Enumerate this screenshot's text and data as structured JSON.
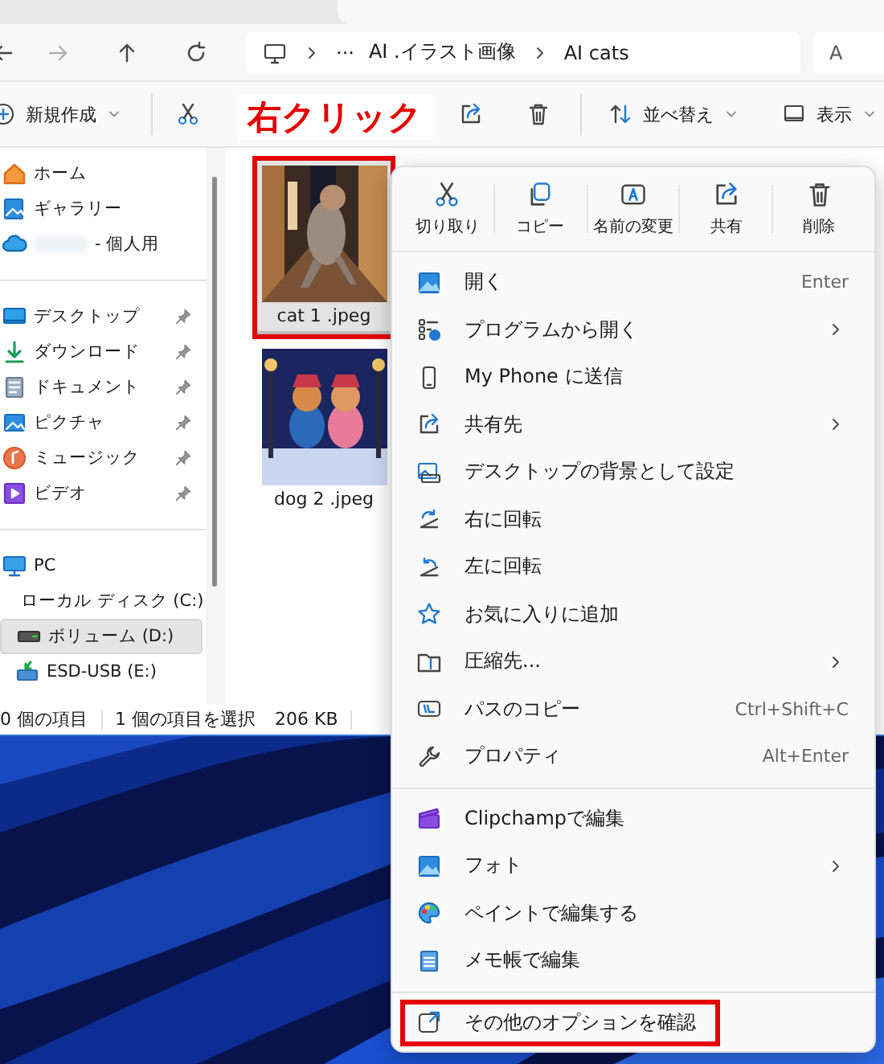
{
  "window": {
    "nav_buttons": [
      {
        "kind": "back",
        "disabled": false
      },
      {
        "kind": "forward",
        "disabled": true
      },
      {
        "kind": "up",
        "disabled": false
      },
      {
        "kind": "refresh",
        "disabled": false
      }
    ],
    "address_bar": {
      "overflow": "···",
      "path": [
        "AI .イラスト画像",
        "AI cats"
      ]
    },
    "search": {
      "placeholder": "A"
    },
    "toolbar": [
      {
        "kind": "new",
        "label": "新規作成",
        "dropdown": true
      },
      {
        "kind": "cut"
      },
      {
        "kind": "share"
      },
      {
        "kind": "delete"
      },
      {
        "kind": "sort",
        "label": "並べ替え",
        "dropdown": true
      },
      {
        "kind": "view",
        "label": "表示",
        "dropdown": true
      }
    ]
  },
  "nav_pane": {
    "groups": [
      [
        {
          "kind": "home",
          "label": "ホーム",
          "pinned": false,
          "selected": false
        },
        {
          "kind": "gallery",
          "label": "ギャラリー",
          "pinned": false,
          "selected": false
        },
        {
          "kind": "cloud",
          "label": "- 個人用",
          "pinned": false,
          "selected": false,
          "blurred": true
        }
      ],
      [
        {
          "kind": "desktop",
          "label": "デスクトップ",
          "pinned": true,
          "selected": false
        },
        {
          "kind": "download",
          "label": "ダウンロード",
          "pinned": true,
          "selected": false
        },
        {
          "kind": "documents",
          "label": "ドキュメント",
          "pinned": true,
          "selected": false
        },
        {
          "kind": "pictures",
          "label": "ピクチャ",
          "pinned": true,
          "selected": false
        },
        {
          "kind": "music",
          "label": "ミュージック",
          "pinned": true,
          "selected": false
        },
        {
          "kind": "videos",
          "label": "ビデオ",
          "pinned": true,
          "selected": false
        }
      ],
      [
        {
          "kind": "pc",
          "label": "PC",
          "pinned": false,
          "selected": false,
          "children": [
            {
              "kind": "drive_c",
              "label": "ローカル ディスク (C:)",
              "pinned": false,
              "selected": false
            },
            {
              "kind": "drive",
              "label": "ボリューム (D:)",
              "pinned": false,
              "selected": true
            },
            {
              "kind": "usb",
              "label": "ESD-USB (E:)",
              "pinned": false,
              "selected": false
            }
          ]
        }
      ]
    ]
  },
  "files": [
    {
      "name": "cat 1 .jpeg",
      "selected": true,
      "highlighted": true
    },
    {
      "name": "dog 2 .jpeg",
      "selected": false,
      "highlighted": false
    }
  ],
  "status_bar": {
    "count": "0 個の項目",
    "selection": "1 個の項目を選択",
    "size": "206 KB"
  },
  "context_menu": {
    "actions": [
      {
        "kind": "cut",
        "label": "切り取り"
      },
      {
        "kind": "copy",
        "label": "コピー"
      },
      {
        "kind": "rename",
        "label": "名前の変更"
      },
      {
        "kind": "share",
        "label": "共有"
      },
      {
        "kind": "delete",
        "label": "削除"
      }
    ],
    "sections": [
      [
        {
          "kind": "open",
          "label": "開く",
          "shortcut": "Enter",
          "submenu": false,
          "highlighted": false
        },
        {
          "kind": "open_with",
          "label": "プログラムから開く",
          "submenu": true,
          "highlighted": false
        },
        {
          "kind": "phone",
          "label": "My Phone に送信",
          "submenu": false,
          "highlighted": false
        },
        {
          "kind": "share_to",
          "label": "共有先",
          "submenu": true,
          "highlighted": false
        },
        {
          "kind": "wallpaper",
          "label": "デスクトップの背景として設定",
          "submenu": false,
          "highlighted": false
        },
        {
          "kind": "rotate_right",
          "label": "右に回転",
          "submenu": false,
          "highlighted": false
        },
        {
          "kind": "rotate_left",
          "label": "左に回転",
          "submenu": false,
          "highlighted": false
        },
        {
          "kind": "star",
          "label": "お気に入りに追加",
          "submenu": false,
          "highlighted": false
        },
        {
          "kind": "zip",
          "label": "圧縮先...",
          "submenu": true,
          "highlighted": false
        },
        {
          "kind": "copy_path",
          "label": "パスのコピー",
          "shortcut": "Ctrl+Shift+C",
          "submenu": false,
          "highlighted": false
        },
        {
          "kind": "properties",
          "label": "プロパティ",
          "shortcut": "Alt+Enter",
          "submenu": false,
          "highlighted": false
        }
      ],
      [
        {
          "kind": "clipchamp",
          "label": "Clipchampで編集",
          "submenu": false,
          "highlighted": false
        },
        {
          "kind": "photos",
          "label": "フォト",
          "submenu": true,
          "highlighted": false
        },
        {
          "kind": "paint",
          "label": "ペイントで編集する",
          "submenu": false,
          "highlighted": false
        },
        {
          "kind": "notepad",
          "label": "メモ帳で編集",
          "submenu": false,
          "highlighted": false
        }
      ],
      [
        {
          "kind": "more",
          "label": "その他のオプションを確認",
          "submenu": false,
          "highlighted": true
        }
      ]
    ]
  },
  "annotation": {
    "text": "右クリック"
  }
}
